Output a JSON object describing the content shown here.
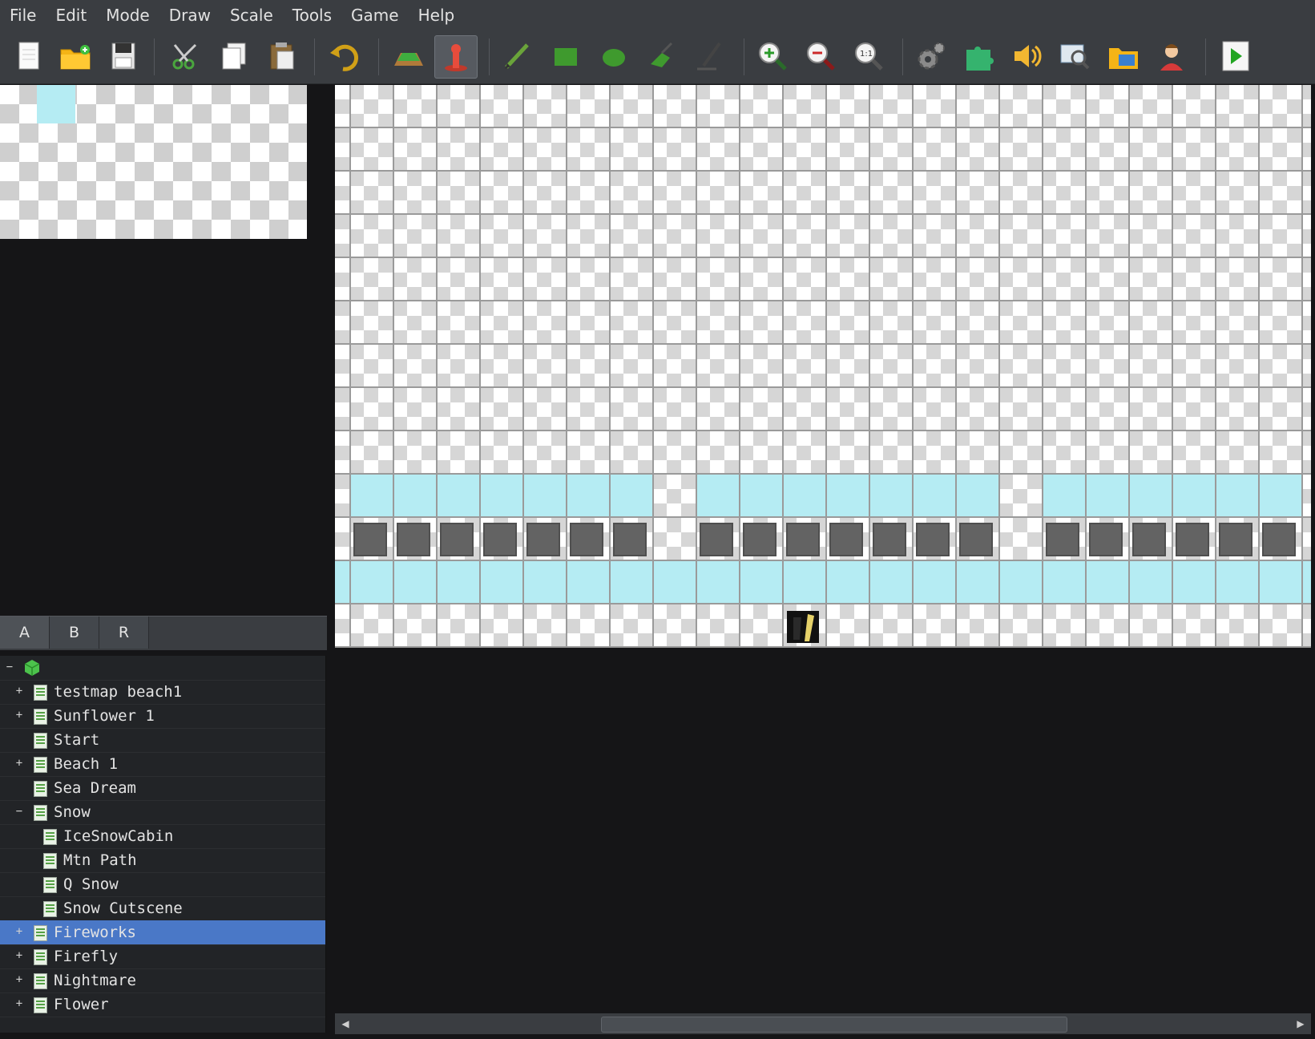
{
  "menu": [
    "File",
    "Edit",
    "Mode",
    "Draw",
    "Scale",
    "Tools",
    "Game",
    "Help"
  ],
  "toolbar": [
    {
      "name": "new-file-icon"
    },
    {
      "name": "open-folder-icon"
    },
    {
      "name": "save-icon"
    },
    {
      "name": "cut-icon"
    },
    {
      "name": "copy-icon"
    },
    {
      "name": "paste-icon"
    },
    {
      "name": "undo-icon"
    },
    {
      "name": "map-mode-icon"
    },
    {
      "name": "event-mode-icon",
      "active": true
    },
    {
      "name": "pencil-icon"
    },
    {
      "name": "rectangle-icon"
    },
    {
      "name": "ellipse-icon"
    },
    {
      "name": "fill-icon"
    },
    {
      "name": "shadow-pen-icon"
    },
    {
      "name": "zoom-in-icon"
    },
    {
      "name": "zoom-out-icon"
    },
    {
      "name": "zoom-actual-icon"
    },
    {
      "name": "database-icon"
    },
    {
      "name": "plugin-icon"
    },
    {
      "name": "sound-icon"
    },
    {
      "name": "event-search-icon"
    },
    {
      "name": "resource-manager-icon"
    },
    {
      "name": "character-generator-icon"
    },
    {
      "name": "playtest-icon"
    }
  ],
  "tabs": [
    "A",
    "B",
    "R"
  ],
  "tree": {
    "items": [
      {
        "label": "testmap beach1",
        "expander": "+",
        "level": 1
      },
      {
        "label": "Sunflower 1",
        "expander": "+",
        "level": 1
      },
      {
        "label": "Start",
        "expander": "",
        "level": 1
      },
      {
        "label": "Beach 1",
        "expander": "+",
        "level": 1
      },
      {
        "label": "Sea Dream",
        "expander": "",
        "level": 1
      },
      {
        "label": "Snow",
        "expander": "−",
        "level": 1
      },
      {
        "label": "IceSnowCabin",
        "expander": "",
        "level": 2
      },
      {
        "label": "Mtn Path",
        "expander": "",
        "level": 2
      },
      {
        "label": "Q Snow",
        "expander": "",
        "level": 2
      },
      {
        "label": "Snow Cutscene",
        "expander": "",
        "level": 2
      },
      {
        "label": "Fireworks",
        "expander": "+",
        "level": 1,
        "selected": true
      },
      {
        "label": "Firefly",
        "expander": "+",
        "level": 1
      },
      {
        "label": "Nightmare",
        "expander": "+",
        "level": 1
      },
      {
        "label": "Flower",
        "expander": "+",
        "level": 1
      }
    ]
  },
  "colors": {
    "water": "#b5ecf3",
    "block": "#636363",
    "selection": "#4a78c7"
  }
}
